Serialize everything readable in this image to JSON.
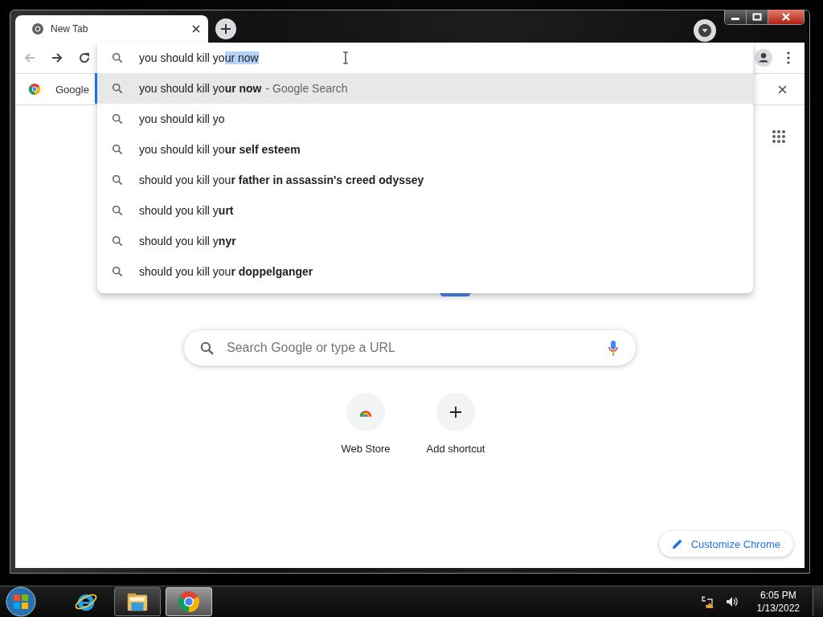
{
  "window": {
    "tab": {
      "title": "New Tab",
      "selected": true
    }
  },
  "toolbar": {
    "back": {
      "disabled": true
    },
    "forward": {
      "disabled": false
    }
  },
  "omnibox": {
    "typed": "you should kill yo",
    "completion": "ur now"
  },
  "suggestions": [
    {
      "text": "you should kill yo**ur now**",
      "suffix": "- Google Search",
      "selected": true
    },
    {
      "text": "you should kill yo",
      "selected": false
    },
    {
      "text": "you should kill yo**ur self esteem**",
      "selected": false
    },
    {
      "text": "should you kill you**r father in assassin's creed odyssey**",
      "selected": false
    },
    {
      "text": "should you kill y**urt**",
      "selected": false
    },
    {
      "text": "should you kill y**nyr**",
      "selected": false
    },
    {
      "text": "should you kill you**r doppelganger**",
      "selected": false
    }
  ],
  "bookmarks": [
    {
      "label": "Google"
    }
  ],
  "search": {
    "placeholder": "Search Google or type a URL"
  },
  "shortcuts": [
    {
      "kind": "site",
      "label": "Web Store"
    },
    {
      "kind": "add",
      "label": "Add shortcut"
    }
  ],
  "customize": {
    "label": "Customize Chrome"
  },
  "taskbar": {
    "apps": [
      {
        "kind": "ie",
        "running": false,
        "selected": false
      },
      {
        "kind": "explorer",
        "running": true,
        "selected": false
      },
      {
        "kind": "chrome",
        "running": true,
        "selected": true
      }
    ],
    "time": "6:05 PM",
    "date": "1/13/2022"
  }
}
